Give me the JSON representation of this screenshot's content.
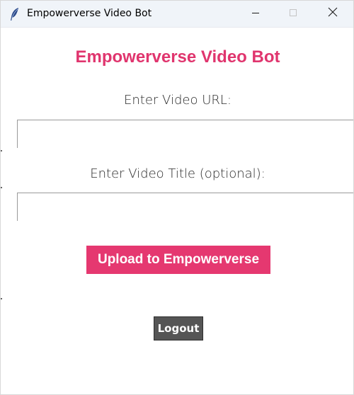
{
  "window": {
    "title": "Empowerverse Video Bot",
    "icon": "feather-icon",
    "controls": {
      "minimize": "minimize-icon",
      "maximize": "maximize-icon",
      "close": "close-icon"
    }
  },
  "main": {
    "heading": "Empowerverse Video Bot",
    "url_label": "Enter Video URL:",
    "url_value": "",
    "title_label": "Enter Video Title (optional):",
    "title_value": "",
    "upload_label": "Upload to Empowerverse",
    "logout_label": "Logout"
  },
  "colors": {
    "accent": "#e53870",
    "heading": "#e0356e",
    "logout_bg": "#555555",
    "titlebar_bg": "#f0f4f9"
  }
}
